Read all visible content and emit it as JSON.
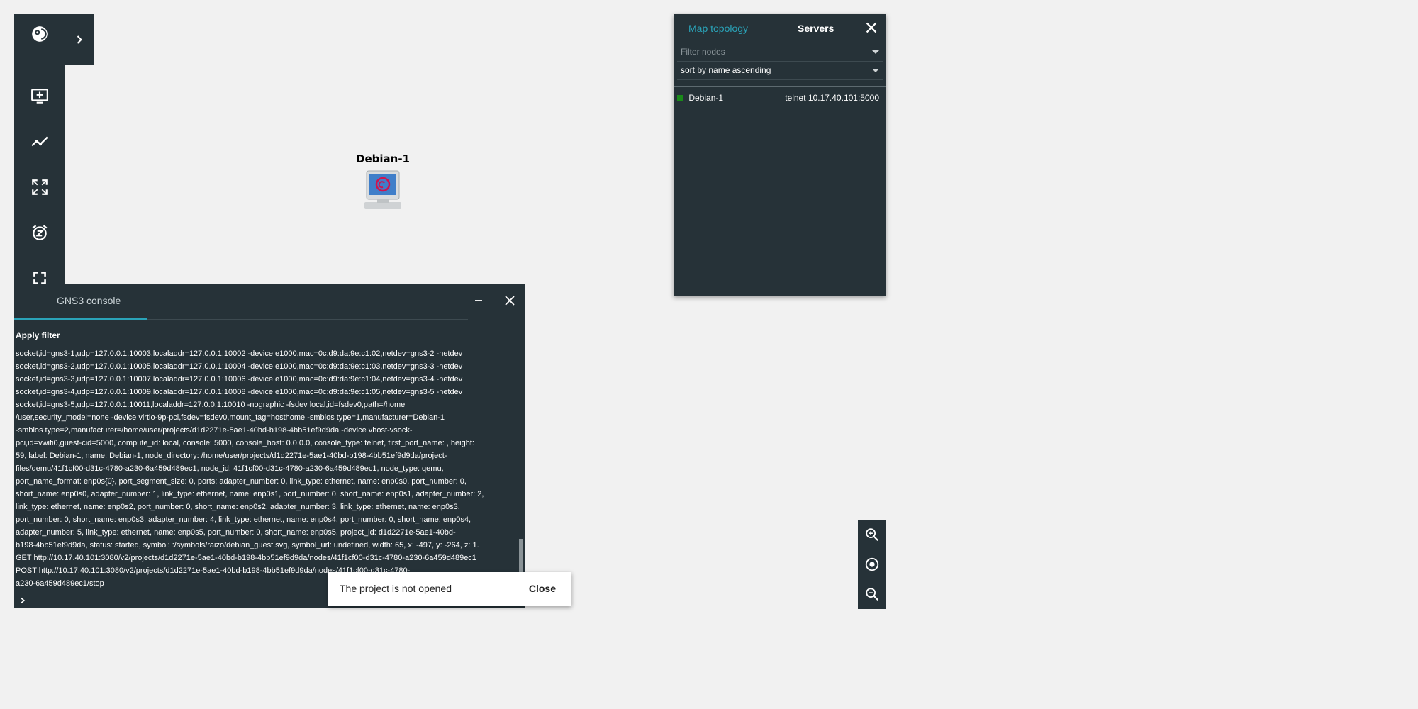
{
  "toolbar": {
    "items": [
      "logo-icon",
      "add-node-icon",
      "draw-link-icon",
      "fit-to-screen-icon",
      "snooze-icon",
      "fullscreen-icon"
    ],
    "expand_icon": "chevron-right-icon"
  },
  "canvas": {
    "node_label": "Debian-1"
  },
  "panel": {
    "tab_topology": "Map topology",
    "tab_servers": "Servers",
    "filter_placeholder": "Filter nodes",
    "sort_value": "sort by name ascending",
    "nodes": [
      {
        "name": "Debian-1",
        "console": "telnet 10.17.40.101:5000",
        "status_color": "#1a8a1a"
      }
    ]
  },
  "console": {
    "title": "GNS3 console",
    "apply_filter": "Apply filter",
    "log": "socket,id=gns3-1,udp=127.0.0.1:10003,localaddr=127.0.0.1:10002 -device e1000,mac=0c:d9:da:9e:c1:02,netdev=gns3-2 -netdev\nsocket,id=gns3-2,udp=127.0.0.1:10005,localaddr=127.0.0.1:10004 -device e1000,mac=0c:d9:da:9e:c1:03,netdev=gns3-3 -netdev\nsocket,id=gns3-3,udp=127.0.0.1:10007,localaddr=127.0.0.1:10006 -device e1000,mac=0c:d9:da:9e:c1:04,netdev=gns3-4 -netdev\nsocket,id=gns3-4,udp=127.0.0.1:10009,localaddr=127.0.0.1:10008 -device e1000,mac=0c:d9:da:9e:c1:05,netdev=gns3-5 -netdev\nsocket,id=gns3-5,udp=127.0.0.1:10011,localaddr=127.0.0.1:10010 -nographic -fsdev local,id=fsdev0,path=/home\n/user,security_model=none -device virtio-9p-pci,fsdev=fsdev0,mount_tag=hosthome -smbios type=1,manufacturer=Debian-1\n-smbios type=2,manufacturer=/home/user/projects/d1d2271e-5ae1-40bd-b198-4bb51ef9d9da -device vhost-vsock-\npci,id=vwifi0,guest-cid=5000, compute_id: local, console: 5000, console_host: 0.0.0.0, console_type: telnet, first_port_name: , height:\n59, label: Debian-1, name: Debian-1, node_directory: /home/user/projects/d1d2271e-5ae1-40bd-b198-4bb51ef9d9da/project-\nfiles/qemu/41f1cf00-d31c-4780-a230-6a459d489ec1, node_id: 41f1cf00-d31c-4780-a230-6a459d489ec1, node_type: qemu,\nport_name_format: enp0s{0}, port_segment_size: 0, ports: adapter_number: 0, link_type: ethernet, name: enp0s0, port_number: 0,\nshort_name: enp0s0, adapter_number: 1, link_type: ethernet, name: enp0s1, port_number: 0, short_name: enp0s1, adapter_number: 2,\nlink_type: ethernet, name: enp0s2, port_number: 0, short_name: enp0s2, adapter_number: 3, link_type: ethernet, name: enp0s3,\nport_number: 0, short_name: enp0s3, adapter_number: 4, link_type: ethernet, name: enp0s4, port_number: 0, short_name: enp0s4,\nadapter_number: 5, link_type: ethernet, name: enp0s5, port_number: 0, short_name: enp0s5, project_id: d1d2271e-5ae1-40bd-\nb198-4bb51ef9d9da, status: started, symbol: :/symbols/raizo/debian_guest.svg, symbol_url: undefined, width: 65, x: -497, y: -264, z: 1.\nGET http://10.17.40.101:3080/v2/projects/d1d2271e-5ae1-40bd-b198-4bb51ef9d9da/nodes/41f1cf00-d31c-4780-a230-6a459d489ec1\nPOST http://10.17.40.101:3080/v2/projects/d1d2271e-5ae1-40bd-b198-4bb51ef9d9da/nodes/41f1cf00-d31c-4780-\na230-6a459d489ec1/stop"
  },
  "snackbar": {
    "message": "The project is not opened",
    "action": "Close"
  },
  "zoom": {
    "items": [
      "zoom-in-icon",
      "reset-zoom-icon",
      "zoom-out-icon"
    ]
  },
  "colors": {
    "panel_bg": "#263238",
    "accent": "#2aa3b8",
    "background": "#f1f1f1"
  }
}
